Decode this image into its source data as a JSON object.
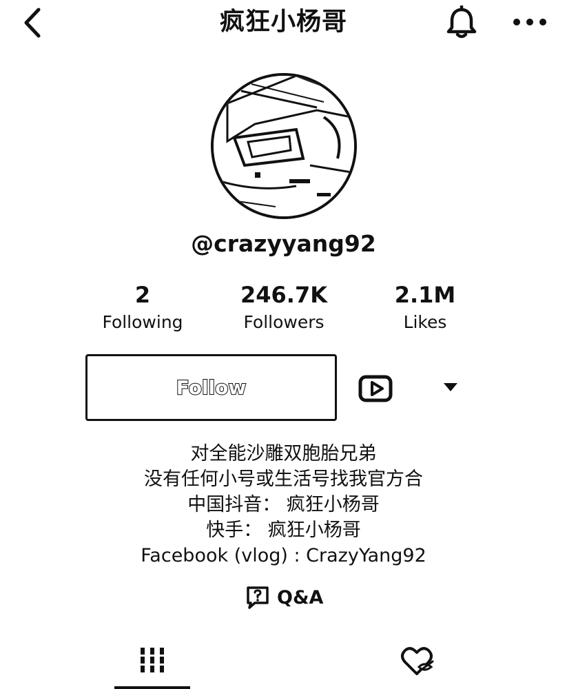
{
  "header": {
    "title": "疯狂小杨哥",
    "back_icon": "chevron-left-icon",
    "bell_icon": "bell-icon",
    "more_icon": "more-horizontal-icon"
  },
  "profile": {
    "username": "@crazyyang92",
    "avatar_icon": "avatar-image"
  },
  "stats": {
    "following_count": "2",
    "following_label": "Following",
    "followers_count": "246.7K",
    "followers_label": "Followers",
    "likes_count": "2.1M",
    "likes_label": "Likes"
  },
  "actions": {
    "follow_label": "Follow",
    "video_icon": "youtube-play-icon",
    "dropdown_icon": "caret-down-icon"
  },
  "bio": {
    "lines": [
      "对全能沙雕双胞胎兄弟",
      "没有任何小号或生活号找我官方合",
      "中国抖音： 疯狂小杨哥",
      "快手：  疯狂小杨哥",
      "Facebook (vlog) : CrazyYang92"
    ]
  },
  "qa": {
    "label": "Q&A",
    "icon": "question-bubble-icon"
  },
  "tabs": {
    "videos_icon": "grid-icon",
    "liked_icon": "hidden-heart-icon",
    "active": "videos"
  }
}
